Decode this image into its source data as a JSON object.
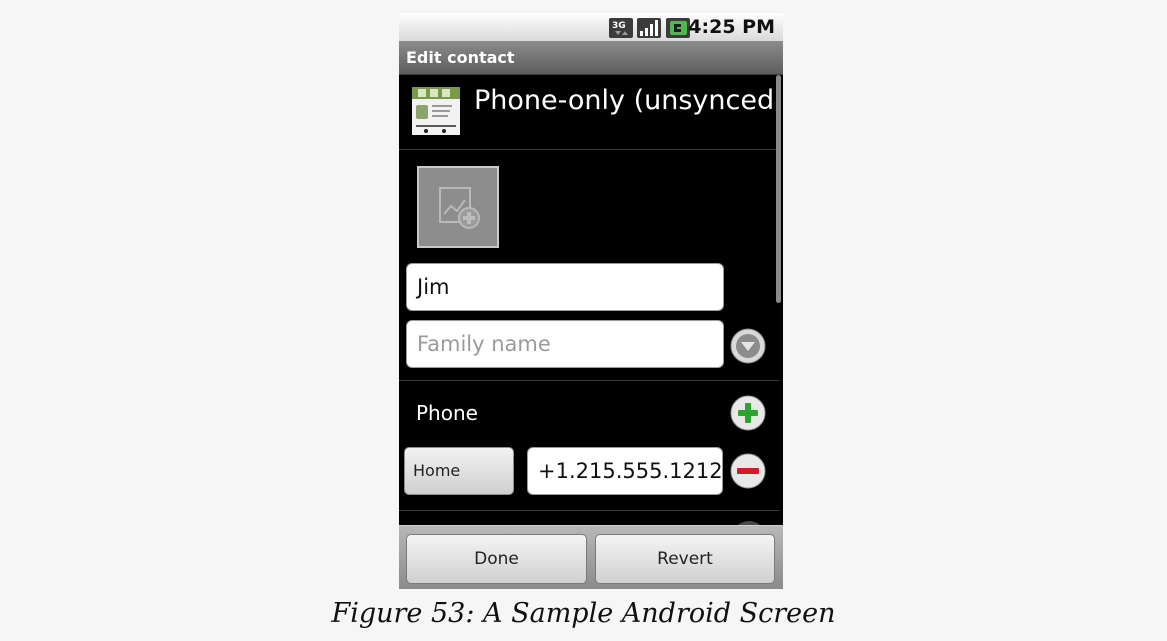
{
  "status_bar": {
    "time": "4:25 PM",
    "icons": [
      "3g-data-icon",
      "signal-bars-icon",
      "battery-charging-icon"
    ],
    "network_label": "3G"
  },
  "title_bar": {
    "title": "Edit contact"
  },
  "account": {
    "icon": "android-mobile-phone-icon",
    "label": "Phone-only (unsynced.."
  },
  "photo": {
    "icon": "add-photo-icon"
  },
  "name": {
    "given_name_value": "Jim",
    "family_name_placeholder": "Family name",
    "expand_icon": "expand-down-icon"
  },
  "phone_section": {
    "label": "Phone",
    "add_icon": "add-icon",
    "entries": [
      {
        "type": "Home",
        "number": "+1.215.555.1212",
        "remove_icon": "remove-icon"
      }
    ]
  },
  "actions": {
    "done_label": "Done",
    "revert_label": "Revert"
  },
  "caption": {
    "text": "Figure 53: A Sample Android Screen"
  },
  "colors": {
    "background": "#000000",
    "add_green": "#2ea32e",
    "remove_red": "#d0192b",
    "title_bar": "#6f6f6f"
  }
}
